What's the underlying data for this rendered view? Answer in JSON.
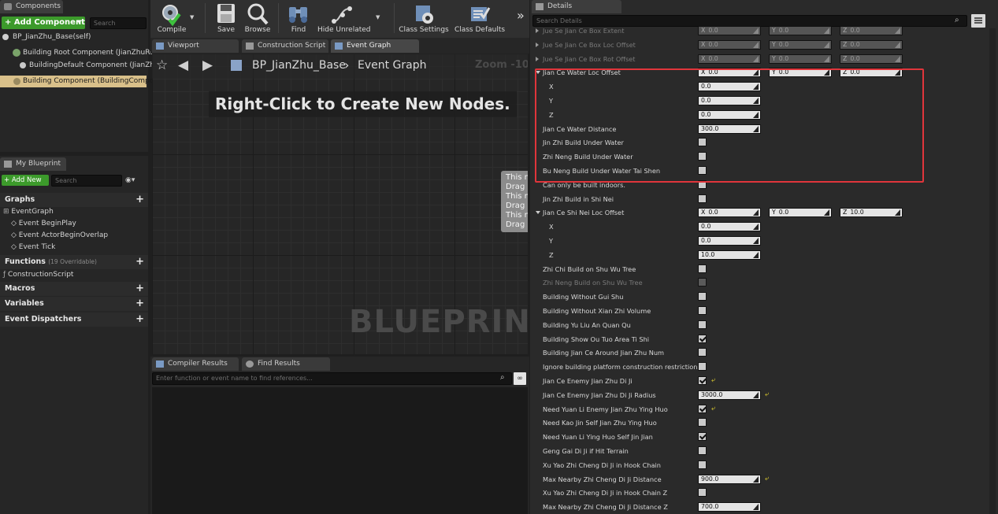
{
  "components_panel": {
    "tab": "Components",
    "add_button": "+ Add Component",
    "search_placeholder": "Search",
    "tree": [
      {
        "label": "BP_JianZhu_Base(self)"
      },
      {
        "label": "Building Root Component (JianZhuRoot"
      },
      {
        "label": "BuildingDefault Component (JianZhu"
      },
      {
        "label": "Building Component (BuildingCompone"
      }
    ]
  },
  "toolbar": {
    "buttons": [
      {
        "label": "Compile",
        "icon": "compile-icon"
      },
      {
        "label": "Save",
        "icon": "save-icon"
      },
      {
        "label": "Browse",
        "icon": "browse-icon"
      },
      {
        "label": "Find",
        "icon": "find-icon"
      },
      {
        "label": "Hide Unrelated",
        "icon": "hide-unrelated-icon"
      },
      {
        "label": "Class Settings",
        "icon": "class-settings-icon"
      },
      {
        "label": "Class Defaults",
        "icon": "class-defaults-icon"
      }
    ],
    "overflow": "»"
  },
  "editor_tabs": [
    "Viewport",
    "Construction Script",
    "Event Graph"
  ],
  "graph": {
    "breadcrumb_root": "BP_JianZhu_Base",
    "breadcrumb_sep": "›",
    "breadcrumb_current": "Event Graph",
    "zoom": "Zoom -10",
    "hint": "Right-Click to Create New Nodes.",
    "watermark": "BLUEPRINT",
    "comment_lines": [
      "This n",
      "Drag c",
      "This n",
      "Drag c",
      "This n",
      "Drag c"
    ]
  },
  "my_blueprint": {
    "tab": "My Blueprint",
    "add_new": "+ Add New",
    "search_placeholder": "Search",
    "graphs_header": "Graphs",
    "graphs": [
      "EventGraph",
      "Event BeginPlay",
      "Event ActorBeginOverlap",
      "Event Tick"
    ],
    "functions_header": "Functions",
    "functions_note": "(19 Overridable)",
    "functions": [
      "ConstructionScript"
    ],
    "macros_header": "Macros",
    "variables_header": "Variables",
    "dispatchers_header": "Event Dispatchers"
  },
  "bottom_tabs": [
    "Compiler Results",
    "Find Results"
  ],
  "find_placeholder": "Enter function or event name to find references...",
  "details": {
    "tab": "Details",
    "search_placeholder": "Search Details",
    "rows": [
      {
        "label": "Jue Se Jian Ce Box Extent",
        "type": "vec",
        "dim": true,
        "x": "0.0",
        "y": "0.0",
        "z": "0.0"
      },
      {
        "label": "Jue Se Jian Ce Box Loc Offset",
        "type": "vec",
        "dim": true,
        "x": "0.0",
        "y": "0.0",
        "z": "0.0"
      },
      {
        "label": "Jue Se Jian Ce Box Rot Offset",
        "type": "vec",
        "dim": true,
        "x": "0.0",
        "y": "0.0",
        "z": "0.0"
      },
      {
        "label": "Jian Ce Water Loc Offset",
        "type": "vec",
        "open": true,
        "x": "0.0",
        "y": "0.0",
        "z": "0.0"
      },
      {
        "label": "X",
        "type": "num",
        "sub": true,
        "value": "0.0"
      },
      {
        "label": "Y",
        "type": "num",
        "sub": true,
        "value": "0.0"
      },
      {
        "label": "Z",
        "type": "num",
        "sub": true,
        "value": "0.0"
      },
      {
        "label": "Jian Ce Water Distance",
        "type": "num",
        "value": "300.0"
      },
      {
        "label": "Jin Zhi Build Under Water",
        "type": "bool",
        "checked": false
      },
      {
        "label": "Zhi Neng Build Under Water",
        "type": "bool",
        "checked": false
      },
      {
        "label": "Bu Neng Build Under Water Tai Shen",
        "type": "bool",
        "checked": false
      },
      {
        "label": "Can only be built indoors.",
        "type": "bool",
        "checked": false
      },
      {
        "label": "Jin Zhi Build in Shi Nei",
        "type": "bool",
        "checked": false
      },
      {
        "label": "Jian Ce Shi Nei Loc Offset",
        "type": "vec",
        "open": true,
        "x": "0.0",
        "y": "0.0",
        "z": "10.0"
      },
      {
        "label": "X",
        "type": "num",
        "sub": true,
        "value": "0.0"
      },
      {
        "label": "Y",
        "type": "num",
        "sub": true,
        "value": "0.0"
      },
      {
        "label": "Z",
        "type": "num",
        "sub": true,
        "value": "10.0"
      },
      {
        "label": "Zhi Chi Build on Shu Wu Tree",
        "type": "bool",
        "checked": false
      },
      {
        "label": "Zhi Neng Build on Shu Wu Tree",
        "type": "bool",
        "checked": false,
        "dim": true
      },
      {
        "label": "Building Without Gui Shu",
        "type": "bool",
        "checked": false
      },
      {
        "label": "Building Without Xian Zhi Volume",
        "type": "bool",
        "checked": false
      },
      {
        "label": "Building Yu Liu An Quan Qu",
        "type": "bool",
        "checked": false
      },
      {
        "label": "Building Show Ou Tuo Area Ti Shi",
        "type": "bool",
        "checked": true
      },
      {
        "label": "Building Jian Ce Around Jian Zhu Num",
        "type": "bool",
        "checked": false
      },
      {
        "label": "Ignore building platform construction restrictions",
        "type": "bool",
        "checked": false
      },
      {
        "label": "Jian Ce Enemy Jian Zhu Di Ji",
        "type": "bool",
        "checked": true,
        "reset": true
      },
      {
        "label": "Jian Ce Enemy Jian Zhu Di Ji Radius",
        "type": "num",
        "value": "3000.0",
        "reset": true
      },
      {
        "label": "Need Yuan Li Enemy Jian Zhu Ying Huo",
        "type": "bool",
        "checked": true,
        "reset": true
      },
      {
        "label": "Need Kao Jin Self Jian Zhu Ying Huo",
        "type": "bool",
        "checked": false
      },
      {
        "label": "Need Yuan Li Ying Huo Self Jin Jian",
        "type": "bool",
        "checked": true
      },
      {
        "label": "Geng Gai Di Ji if Hit Terrain",
        "type": "bool",
        "checked": false
      },
      {
        "label": "Xu Yao Zhi Cheng Di Ji in Hook Chain",
        "type": "bool",
        "checked": false
      },
      {
        "label": "Max Nearby Zhi Cheng Di Ji Distance",
        "type": "num",
        "value": "900.0",
        "reset": true
      },
      {
        "label": "Xu Yao Zhi Cheng Di Ji in Hook Chain Z",
        "type": "bool",
        "checked": false
      },
      {
        "label": "Max Nearby Zhi Cheng Di Ji Distance Z",
        "type": "num",
        "value": "700.0"
      }
    ],
    "axis_labels": [
      "X",
      "Y",
      "Z"
    ],
    "reset_glyph": "⤶"
  },
  "colors": {
    "highlight": "#e0353b",
    "add_green": "#3c9a2b",
    "selected": "#d9c08a"
  }
}
